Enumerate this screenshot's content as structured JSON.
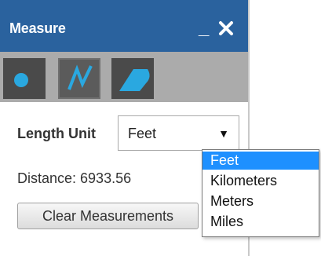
{
  "header": {
    "title": "Measure",
    "minimize_label": "_",
    "close_icon": "close-icon"
  },
  "colors": {
    "titlebar": "#2a629e",
    "toolbar": "#ababab",
    "tool_bg": "#4a4a4a",
    "tool_icon": "#2aa8e0",
    "dropdown_highlight": "#1e90ff"
  },
  "tools": [
    {
      "name": "point-tool",
      "icon": "point-icon",
      "active": false
    },
    {
      "name": "line-tool",
      "icon": "polyline-icon",
      "active": true
    },
    {
      "name": "area-tool",
      "icon": "area-icon",
      "active": false
    }
  ],
  "length_unit": {
    "label": "Length Unit",
    "selected": "Feet",
    "options": [
      "Feet",
      "Kilometers",
      "Meters",
      "Miles"
    ]
  },
  "distance": {
    "text": "Distance: 6933.56"
  },
  "actions": {
    "clear_label": "Clear Measurements"
  }
}
